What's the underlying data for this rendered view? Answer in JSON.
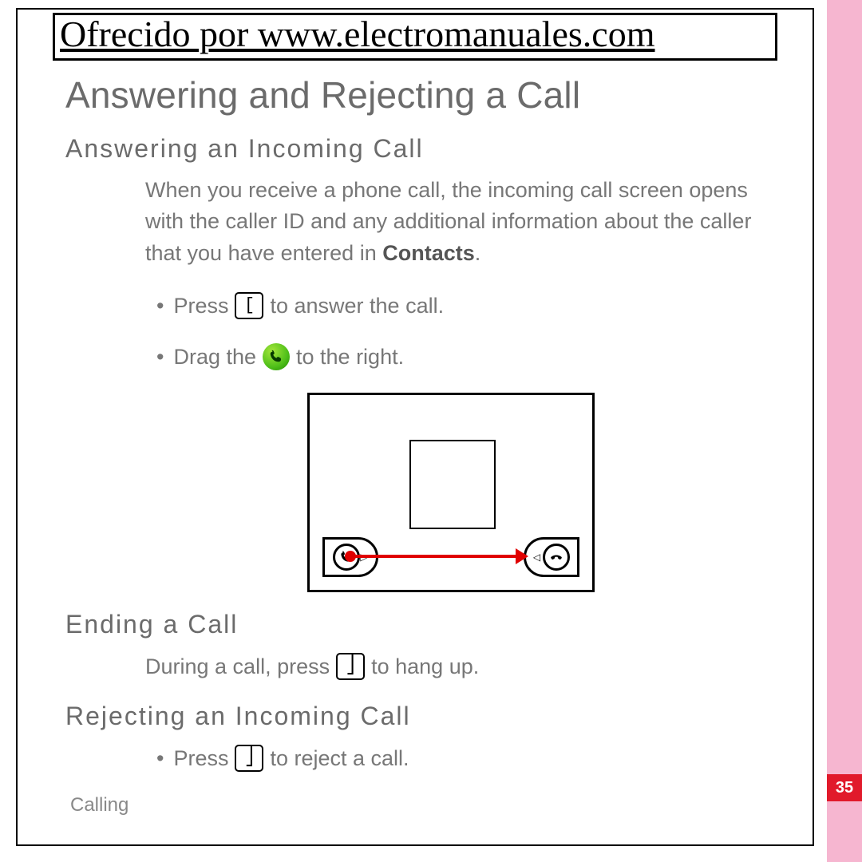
{
  "banner": "Ofrecido por www.electromanuales.com",
  "page_number": "35",
  "footer_section": "Calling",
  "title": "Answering and Rejecting a Call",
  "sections": {
    "answering": {
      "heading": "Answering an Incoming Call",
      "para_pre": "When you receive a phone call, the incoming call screen opens with the caller ID and any additional information about the caller that you have entered in ",
      "para_bold": "Contacts",
      "para_post": ".",
      "bullet1_pre": "Press",
      "bullet1_post": "to answer the call.",
      "bullet2_pre": "Drag the",
      "bullet2_post": "to the right."
    },
    "ending": {
      "heading": "Ending a Call",
      "line_pre": "During a call, press",
      "line_post": "to hang up."
    },
    "rejecting": {
      "heading": "Rejecting an Incoming Call",
      "bullet_pre": "Press",
      "bullet_post": "to reject a call."
    }
  },
  "icons": {
    "key_open": "[",
    "key_close_1": "⎦",
    "key_close_2": "⎦"
  }
}
